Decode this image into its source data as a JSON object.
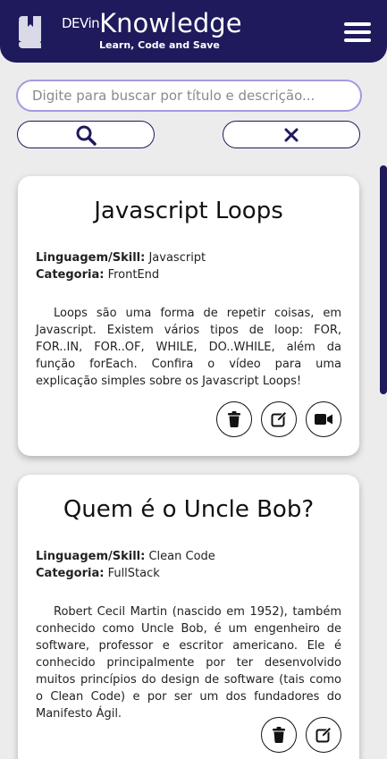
{
  "header": {
    "brand_small": "DEVin",
    "brand_big": "Knowledge",
    "tagline": "Learn, Code and Save"
  },
  "search": {
    "placeholder": "Digite para buscar por título e descrição..."
  },
  "cards": [
    {
      "title": "Javascript Loops",
      "skill_label": "Linguagem/Skill:",
      "skill": "Javascript",
      "category_label": "Categoria:",
      "category": "FrontEnd",
      "description": "Loops são uma forma de repetir coisas, em Javascript. Existem vários tipos de loop: FOR, FOR..IN, FOR..OF, WHILE, DO..WHILE, além da função forEach. Confira o vídeo para uma explicação simples sobre os Javascript Loops!",
      "actions": [
        "trash-icon",
        "edit-icon",
        "video-icon"
      ]
    },
    {
      "title": "Quem é o Uncle Bob?",
      "skill_label": "Linguagem/Skill:",
      "skill": "Clean Code",
      "category_label": "Categoria:",
      "category": "FullStack",
      "description": "Robert Cecil Martin (nascido em 1952), também conhecido como Uncle Bob, é um engenheiro de software, professor e escritor americano. Ele é conhecido principalmente por ter desenvolvido muitos princípios do design de software (tais como o Clean Code) e por ser um dos fundadores do Manifesto Ágil.",
      "actions": [
        "trash-icon",
        "edit-icon"
      ]
    }
  ],
  "colors": {
    "primary": "#1e1a5c",
    "background": "#ececec",
    "search_border": "#a19be0"
  }
}
